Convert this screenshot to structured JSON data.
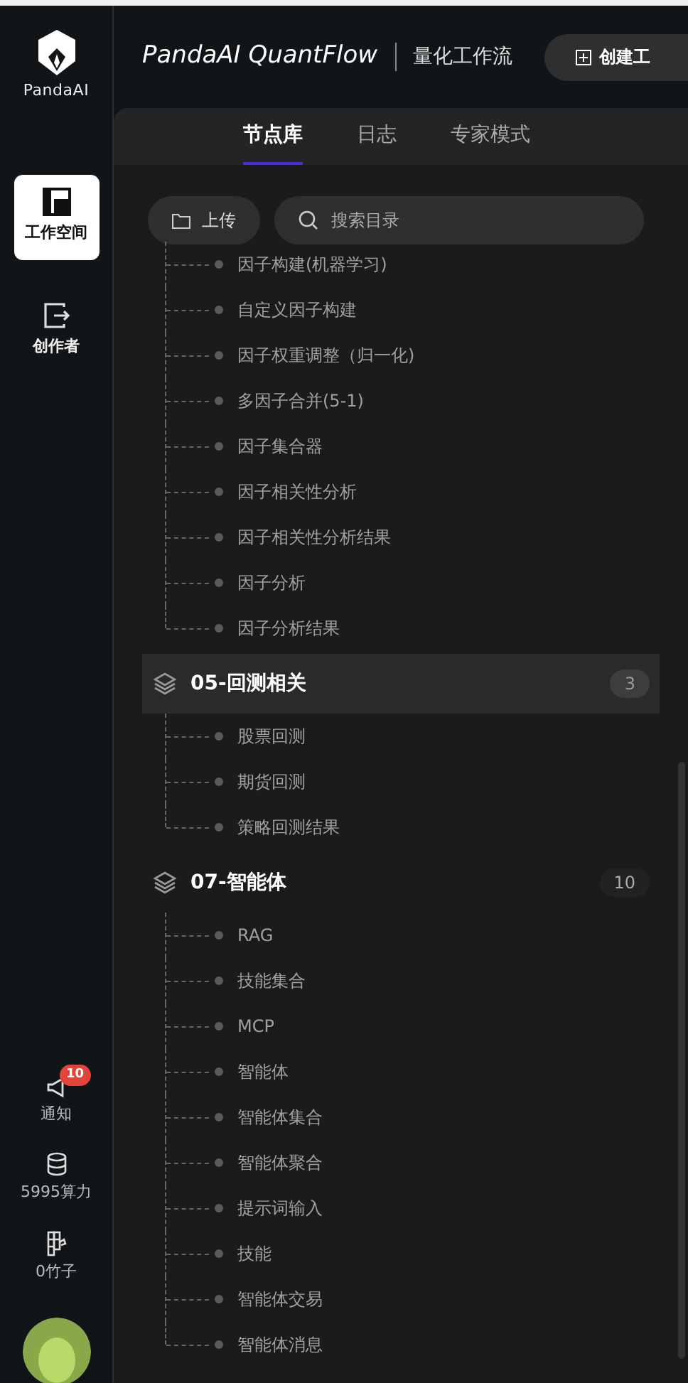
{
  "brand": {
    "name": "PandaAI"
  },
  "nav": [
    {
      "label": "工作空间",
      "selected": true,
      "kind": "layout"
    },
    {
      "label": "创作者",
      "selected": false,
      "kind": "exit"
    }
  ],
  "nav_bottom": [
    {
      "label": "通知",
      "kind": "notify",
      "badge": "10"
    },
    {
      "label": "5995算力",
      "kind": "coins"
    },
    {
      "label": "0竹子",
      "kind": "bamboo"
    }
  ],
  "header": {
    "title": "PandaAI QuantFlow",
    "subtitle": "量化工作流",
    "create_button": "创建工"
  },
  "tabs": [
    {
      "label": "节点库",
      "selected": true
    },
    {
      "label": "日志",
      "selected": false
    },
    {
      "label": "专家模式",
      "selected": false
    }
  ],
  "upload_button": "上传",
  "search": {
    "placeholder": "搜索目录"
  },
  "partial_group_items": [
    "因子构建(机器学习)",
    "自定义因子构建",
    "因子权重调整（归一化)",
    "多因子合并(5-1)",
    "因子集合器",
    "因子相关性分析",
    "因子相关性分析结果",
    "因子分析",
    "因子分析结果"
  ],
  "groups": [
    {
      "title": "05-回测相关",
      "count": "3",
      "highlighted": true,
      "items": [
        "股票回测",
        "期货回测",
        "策略回测结果"
      ]
    },
    {
      "title": "07-智能体",
      "count": "10",
      "highlighted": false,
      "items": [
        "RAG",
        "技能集合",
        "MCP",
        "智能体",
        "智能体集合",
        "智能体聚合",
        "提示词输入",
        "技能",
        "智能体交易",
        "智能体消息"
      ]
    }
  ]
}
